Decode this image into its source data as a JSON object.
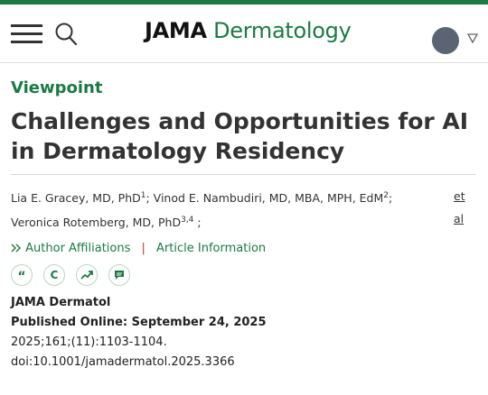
{
  "header": {
    "logo_brand": "JAMA",
    "logo_journal": "Dermatology",
    "icons": {
      "menu": "menu-icon",
      "search": "search-icon",
      "account": "avatar",
      "dropdown": "caret-down-icon"
    }
  },
  "article": {
    "section": "Viewpoint",
    "title": "Challenges and Opportunities for AI in Dermatology Residency",
    "authors": [
      {
        "name": "Lia E. Gracey, MD, PhD",
        "sup": "1",
        "sep": "; "
      },
      {
        "name": "Vinod E. Nambudiri, MD, MBA, MPH, EdM",
        "sup": "2",
        "sep": ";"
      },
      {
        "name": "Veronica Rotemberg, MD, PhD",
        "sup": "3,4",
        "sep": " ;"
      }
    ],
    "etal_1": "et",
    "etal_2": "al",
    "affiliations_label": "Author Affiliations",
    "separator": "|",
    "article_info_label": "Article Information",
    "tools": [
      "quote-icon",
      "copyright-icon",
      "trending-icon",
      "comment-icon"
    ],
    "tool_glyphs": {
      "quote": "“",
      "copyright": "C"
    },
    "journal_abbrev": "JAMA Dermatol",
    "published": "Published Online: September 24, 2025",
    "citation": "2025;161;(11):1103-1104.",
    "doi": "doi:10.1001/jamadermatol.2025.3366"
  },
  "colors": {
    "accent": "#1b7a43",
    "separator": "#c0392b",
    "text": "#333333",
    "avatar": "#5a6473"
  }
}
